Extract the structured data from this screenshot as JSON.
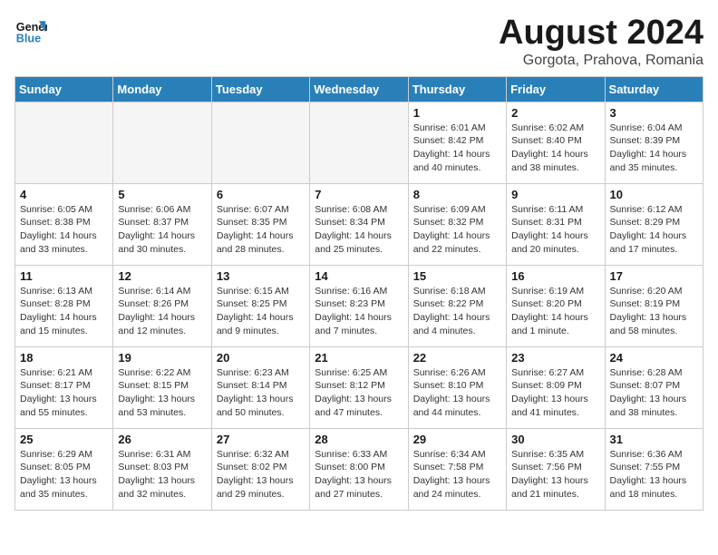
{
  "header": {
    "logo_line1": "General",
    "logo_line2": "Blue",
    "month_year": "August 2024",
    "location": "Gorgota, Prahova, Romania"
  },
  "weekdays": [
    "Sunday",
    "Monday",
    "Tuesday",
    "Wednesday",
    "Thursday",
    "Friday",
    "Saturday"
  ],
  "weeks": [
    [
      {
        "day": "",
        "info": "",
        "empty": true
      },
      {
        "day": "",
        "info": "",
        "empty": true
      },
      {
        "day": "",
        "info": "",
        "empty": true
      },
      {
        "day": "",
        "info": "",
        "empty": true
      },
      {
        "day": "1",
        "info": "Sunrise: 6:01 AM\nSunset: 8:42 PM\nDaylight: 14 hours\nand 40 minutes."
      },
      {
        "day": "2",
        "info": "Sunrise: 6:02 AM\nSunset: 8:40 PM\nDaylight: 14 hours\nand 38 minutes."
      },
      {
        "day": "3",
        "info": "Sunrise: 6:04 AM\nSunset: 8:39 PM\nDaylight: 14 hours\nand 35 minutes."
      }
    ],
    [
      {
        "day": "4",
        "info": "Sunrise: 6:05 AM\nSunset: 8:38 PM\nDaylight: 14 hours\nand 33 minutes."
      },
      {
        "day": "5",
        "info": "Sunrise: 6:06 AM\nSunset: 8:37 PM\nDaylight: 14 hours\nand 30 minutes."
      },
      {
        "day": "6",
        "info": "Sunrise: 6:07 AM\nSunset: 8:35 PM\nDaylight: 14 hours\nand 28 minutes."
      },
      {
        "day": "7",
        "info": "Sunrise: 6:08 AM\nSunset: 8:34 PM\nDaylight: 14 hours\nand 25 minutes."
      },
      {
        "day": "8",
        "info": "Sunrise: 6:09 AM\nSunset: 8:32 PM\nDaylight: 14 hours\nand 22 minutes."
      },
      {
        "day": "9",
        "info": "Sunrise: 6:11 AM\nSunset: 8:31 PM\nDaylight: 14 hours\nand 20 minutes."
      },
      {
        "day": "10",
        "info": "Sunrise: 6:12 AM\nSunset: 8:29 PM\nDaylight: 14 hours\nand 17 minutes."
      }
    ],
    [
      {
        "day": "11",
        "info": "Sunrise: 6:13 AM\nSunset: 8:28 PM\nDaylight: 14 hours\nand 15 minutes."
      },
      {
        "day": "12",
        "info": "Sunrise: 6:14 AM\nSunset: 8:26 PM\nDaylight: 14 hours\nand 12 minutes."
      },
      {
        "day": "13",
        "info": "Sunrise: 6:15 AM\nSunset: 8:25 PM\nDaylight: 14 hours\nand 9 minutes."
      },
      {
        "day": "14",
        "info": "Sunrise: 6:16 AM\nSunset: 8:23 PM\nDaylight: 14 hours\nand 7 minutes."
      },
      {
        "day": "15",
        "info": "Sunrise: 6:18 AM\nSunset: 8:22 PM\nDaylight: 14 hours\nand 4 minutes."
      },
      {
        "day": "16",
        "info": "Sunrise: 6:19 AM\nSunset: 8:20 PM\nDaylight: 14 hours\nand 1 minute."
      },
      {
        "day": "17",
        "info": "Sunrise: 6:20 AM\nSunset: 8:19 PM\nDaylight: 13 hours\nand 58 minutes."
      }
    ],
    [
      {
        "day": "18",
        "info": "Sunrise: 6:21 AM\nSunset: 8:17 PM\nDaylight: 13 hours\nand 55 minutes."
      },
      {
        "day": "19",
        "info": "Sunrise: 6:22 AM\nSunset: 8:15 PM\nDaylight: 13 hours\nand 53 minutes."
      },
      {
        "day": "20",
        "info": "Sunrise: 6:23 AM\nSunset: 8:14 PM\nDaylight: 13 hours\nand 50 minutes."
      },
      {
        "day": "21",
        "info": "Sunrise: 6:25 AM\nSunset: 8:12 PM\nDaylight: 13 hours\nand 47 minutes."
      },
      {
        "day": "22",
        "info": "Sunrise: 6:26 AM\nSunset: 8:10 PM\nDaylight: 13 hours\nand 44 minutes."
      },
      {
        "day": "23",
        "info": "Sunrise: 6:27 AM\nSunset: 8:09 PM\nDaylight: 13 hours\nand 41 minutes."
      },
      {
        "day": "24",
        "info": "Sunrise: 6:28 AM\nSunset: 8:07 PM\nDaylight: 13 hours\nand 38 minutes."
      }
    ],
    [
      {
        "day": "25",
        "info": "Sunrise: 6:29 AM\nSunset: 8:05 PM\nDaylight: 13 hours\nand 35 minutes."
      },
      {
        "day": "26",
        "info": "Sunrise: 6:31 AM\nSunset: 8:03 PM\nDaylight: 13 hours\nand 32 minutes."
      },
      {
        "day": "27",
        "info": "Sunrise: 6:32 AM\nSunset: 8:02 PM\nDaylight: 13 hours\nand 29 minutes."
      },
      {
        "day": "28",
        "info": "Sunrise: 6:33 AM\nSunset: 8:00 PM\nDaylight: 13 hours\nand 27 minutes."
      },
      {
        "day": "29",
        "info": "Sunrise: 6:34 AM\nSunset: 7:58 PM\nDaylight: 13 hours\nand 24 minutes."
      },
      {
        "day": "30",
        "info": "Sunrise: 6:35 AM\nSunset: 7:56 PM\nDaylight: 13 hours\nand 21 minutes."
      },
      {
        "day": "31",
        "info": "Sunrise: 6:36 AM\nSunset: 7:55 PM\nDaylight: 13 hours\nand 18 minutes."
      }
    ]
  ]
}
